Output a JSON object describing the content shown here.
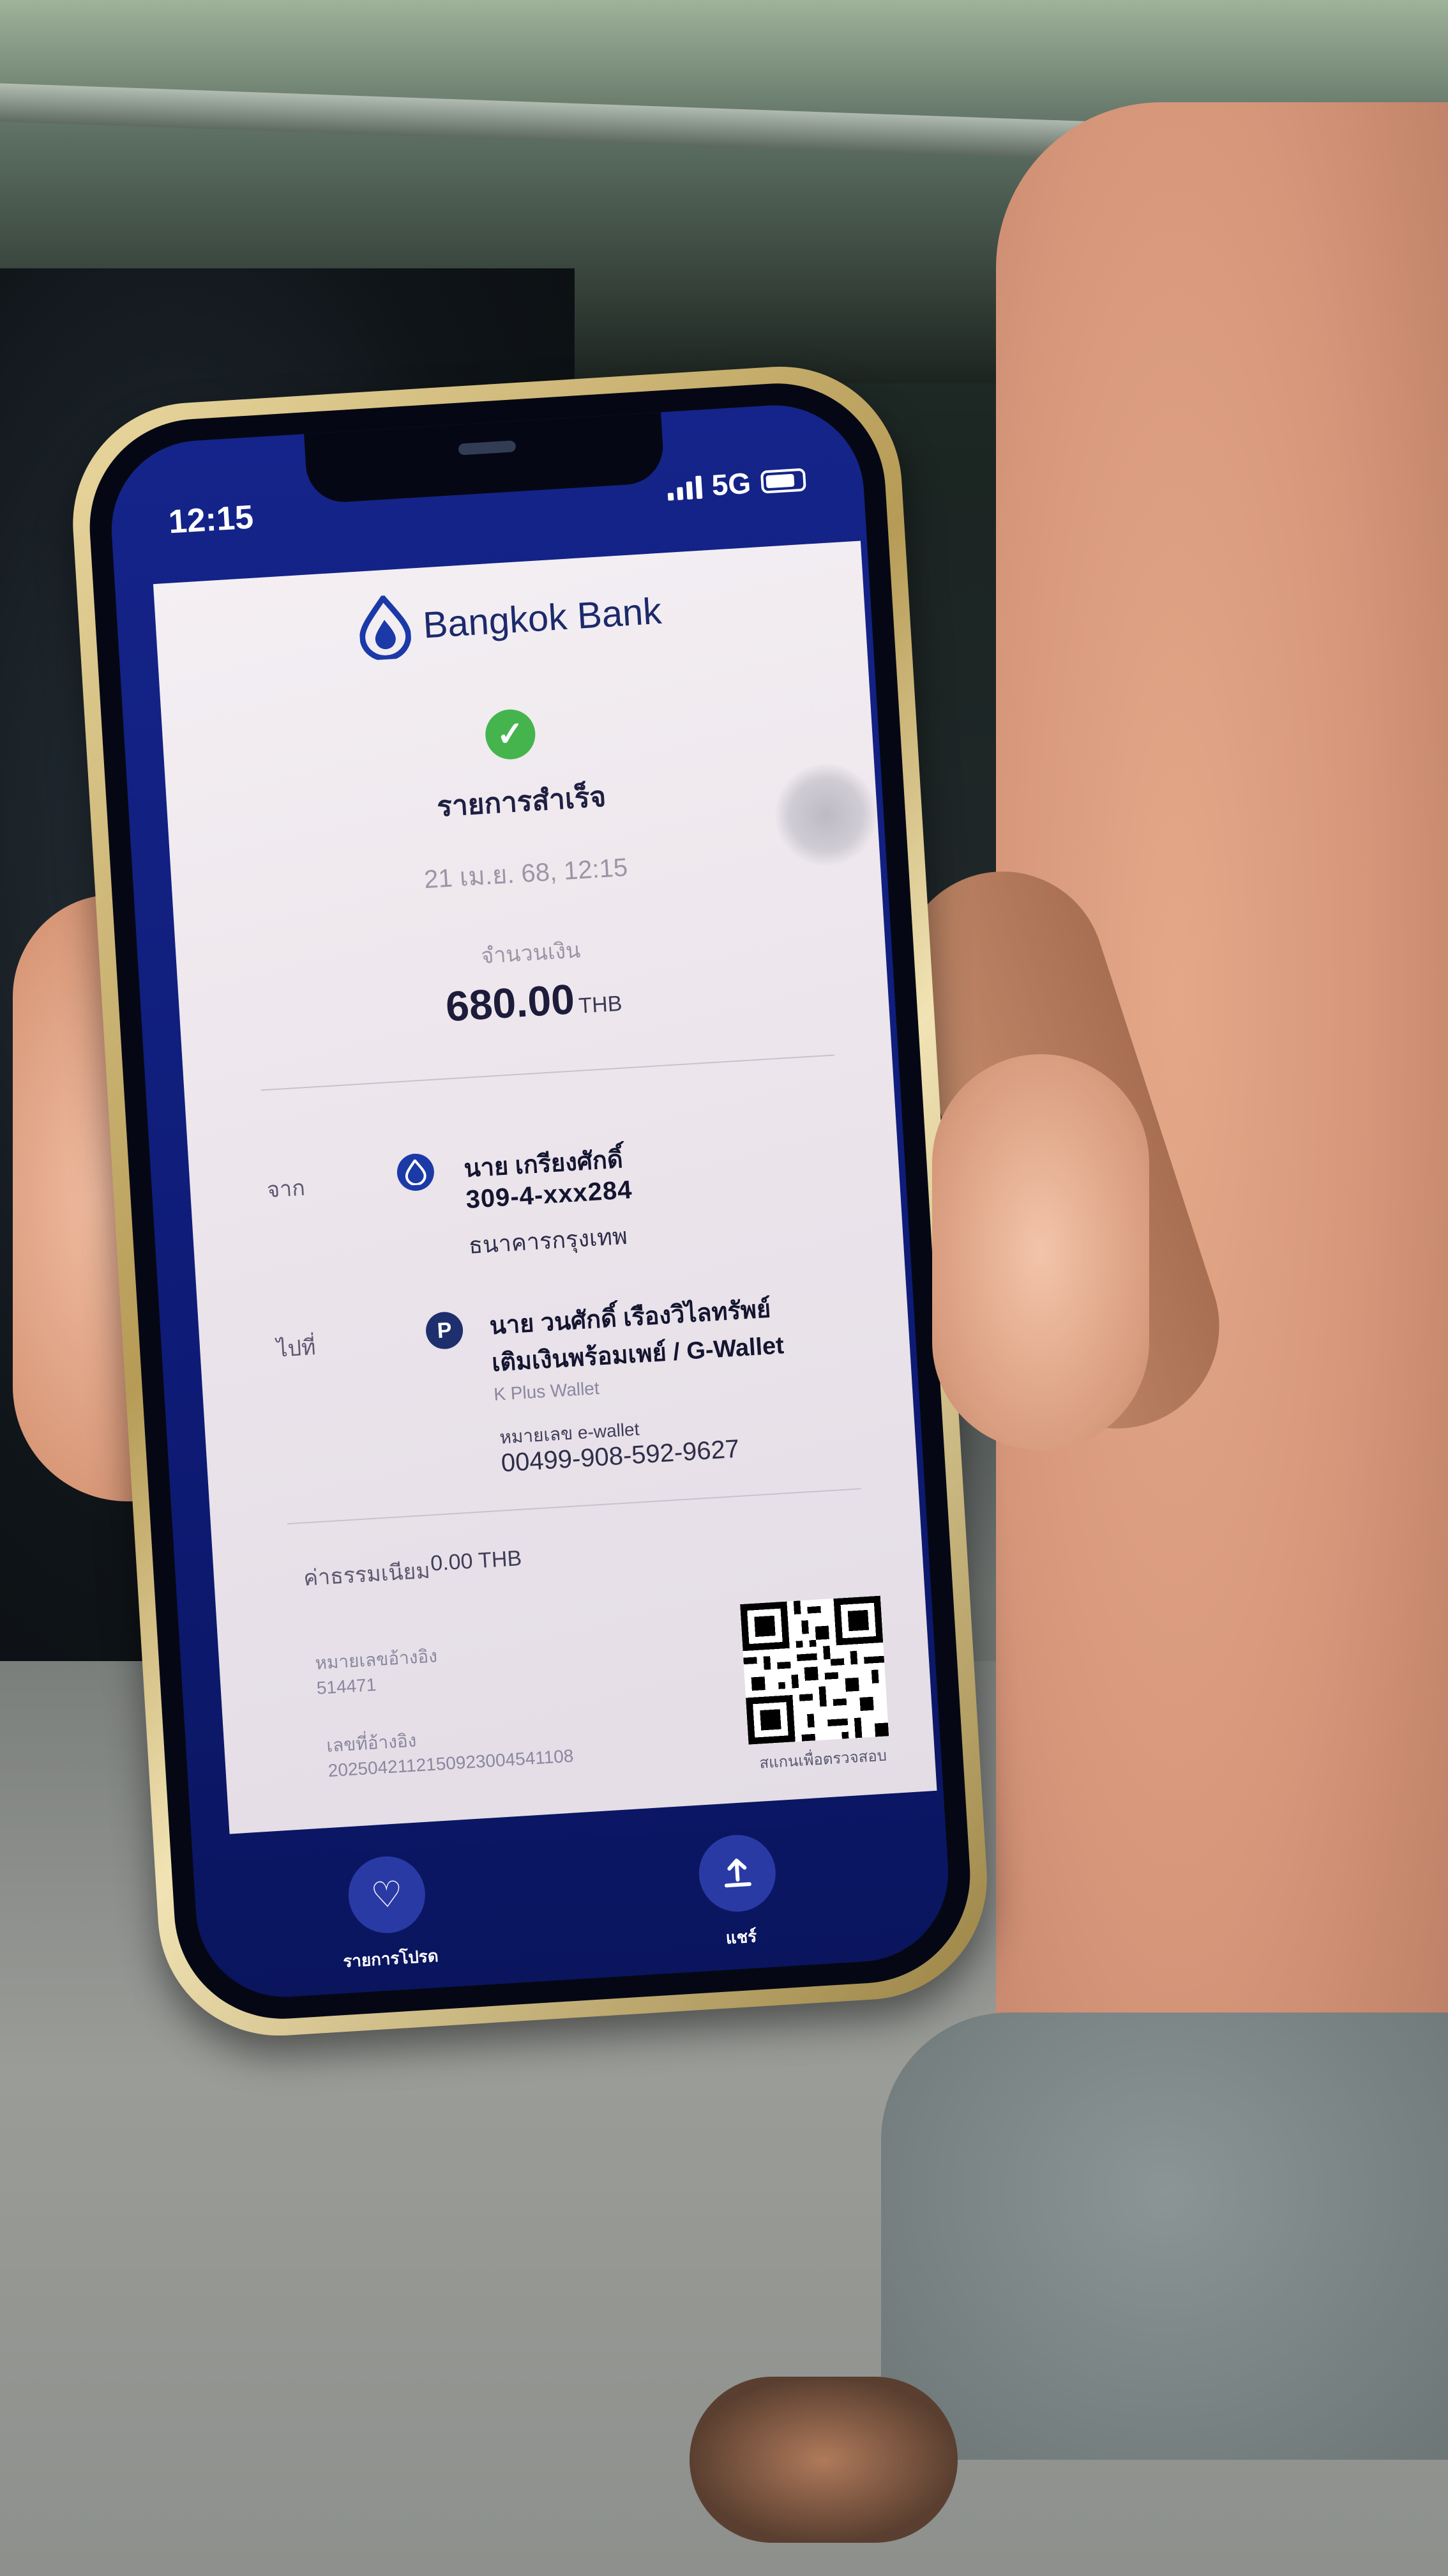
{
  "status_bar": {
    "time": "12:15",
    "network": "5G"
  },
  "receipt": {
    "bank_name": "Bangkok Bank",
    "status": "รายการสำเร็จ",
    "datetime": "21 เม.ย. 68, 12:15",
    "amount_label": "จำนวนเงิน",
    "amount": "680.00",
    "currency": "THB",
    "from": {
      "label": "จาก",
      "name": "นาย เกรียงศักดิ์",
      "account": "309-4-xxx284",
      "bank": "ธนาคารกรุงเทพ"
    },
    "to": {
      "label": "ไปที่",
      "name": "นาย วนศักดิ์ เรืองวิไลทรัพย์",
      "service": "เติมเงินพร้อมเพย์ / G-Wallet",
      "wallet_type": "K Plus Wallet",
      "wallet_label": "หมายเลข e-wallet",
      "wallet_number": "00499-908-592-9627"
    },
    "fee_label": "ค่าธรรมเนียม",
    "fee": "0.00 THB",
    "ref_label": "หมายเลขอ้างอิง",
    "ref": "514471",
    "ref2_label": "เลขที่อ้างอิง",
    "ref2": "2025042112150923004541108",
    "qr_caption": "สแกนเพื่อตรวจสอบ"
  },
  "actions": {
    "favorite_label": "รายการโปรด",
    "share_label": "แชร์"
  },
  "colors": {
    "bank_blue": "#1b3aa8",
    "success_green": "#45b44d",
    "promptpay_navy": "#1e2f6e"
  }
}
